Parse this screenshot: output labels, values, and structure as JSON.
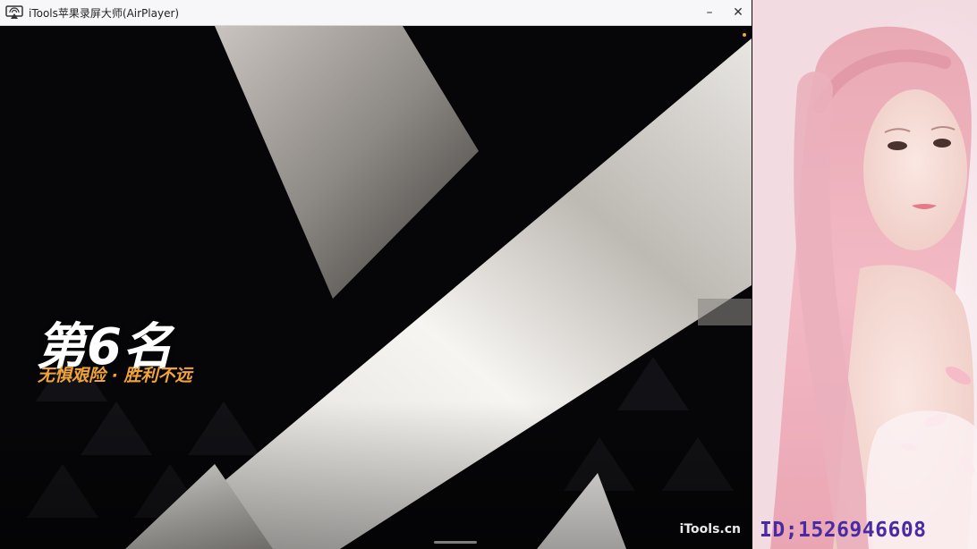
{
  "window": {
    "title": "iTools苹果录屏大师(AirPlayer)",
    "minimize_glyph": "–",
    "close_glyph": "✕",
    "app_icon": "airplay-icon"
  },
  "game": {
    "rank_text": "第6名",
    "motto_text": "无惧艰险 · 胜利不远",
    "watermark": "iTools.cn"
  },
  "stream": {
    "id_label": "ID;1526946608"
  },
  "colors": {
    "accent_orange": "#f2a33a",
    "id_purple": "#4a2aa3",
    "hair_pink": "#f0b3c2"
  }
}
